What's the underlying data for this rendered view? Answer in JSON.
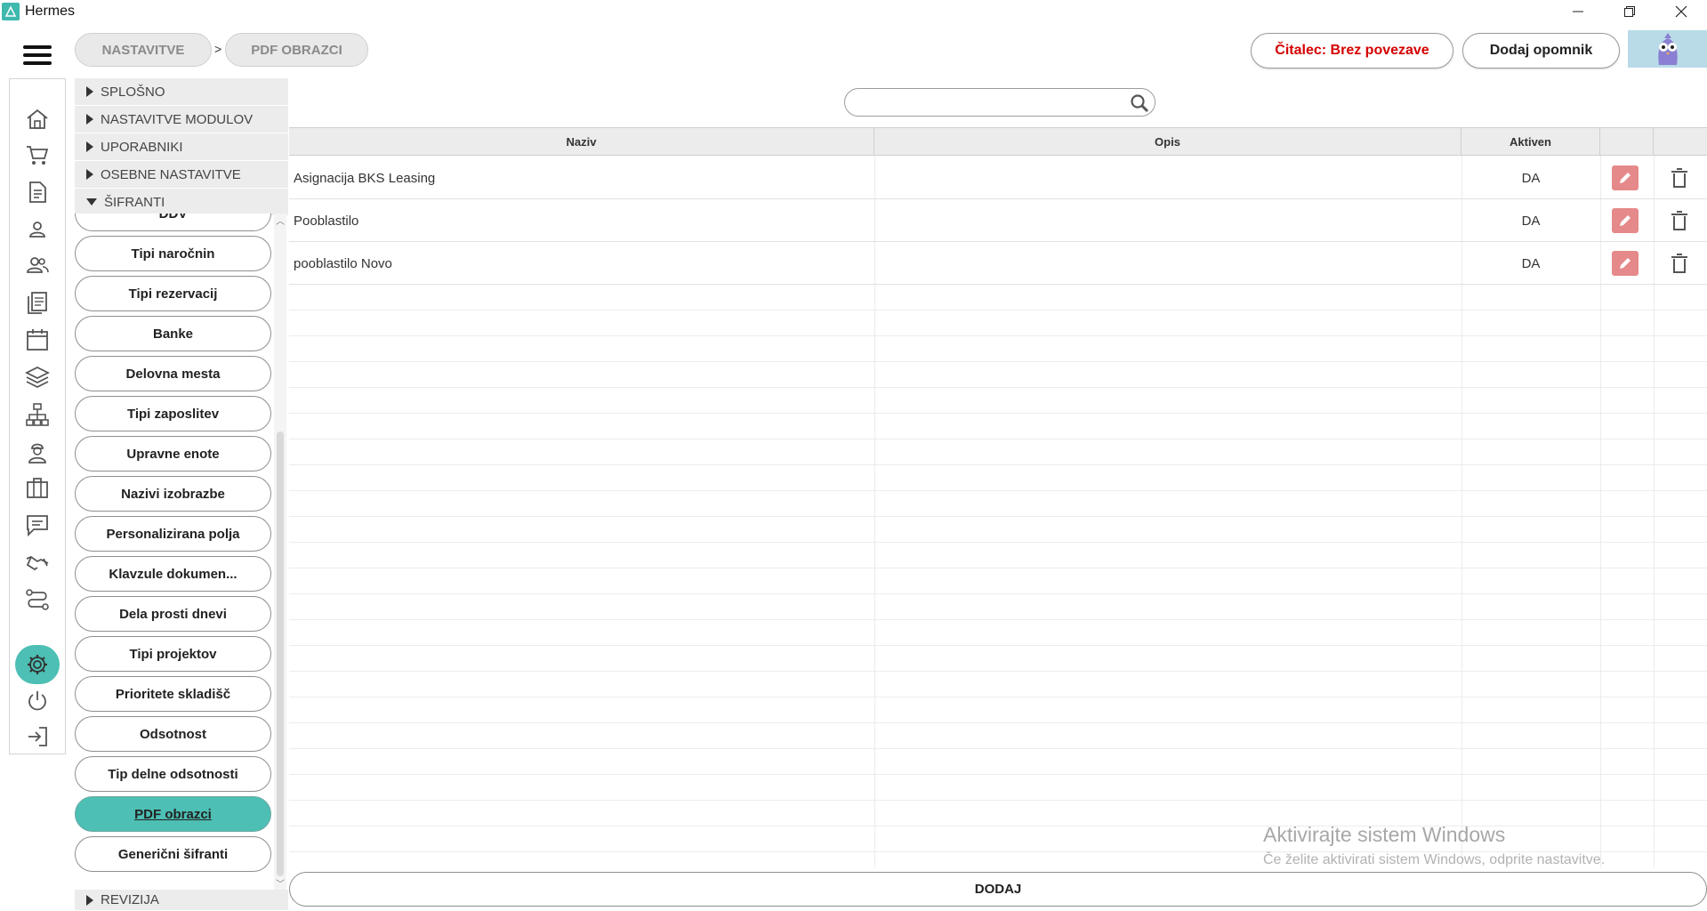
{
  "window": {
    "title": "Hermes"
  },
  "header": {
    "breadcrumbs": [
      "NASTAVITVE",
      "PDF OBRAZCI"
    ],
    "breadcrumb_separator": ">",
    "reader_status": "Čitalec: Brez povezave",
    "reader_status_color": "#d40000",
    "add_reminder_label": "Dodaj opomnik"
  },
  "sidebar_icons": [
    "home-icon",
    "cart-icon",
    "document-icon",
    "person-icon",
    "people-icon",
    "documents-icon",
    "calendar-icon",
    "layers-icon",
    "hierarchy-icon",
    "worker-icon",
    "briefcase-icon",
    "chat-icon",
    "handshake-icon",
    "route-icon",
    "gear-icon",
    "power-icon",
    "logout-icon"
  ],
  "settings_tree": {
    "sections": [
      "SPLOŠNO",
      "NASTAVITVE MODULOV",
      "UPORABNIKI",
      "OSEBNE NASTAVITVE",
      "ŠIFRANTI",
      "REVIZIJA"
    ],
    "expanded": "ŠIFRANTI",
    "items": [
      "DDV",
      "Tipi naročnin",
      "Tipi rezervacij",
      "Banke",
      "Delovna mesta",
      "Tipi zaposlitev",
      "Upravne enote",
      "Nazivi izobrazbe",
      "Personalizirana polja",
      "Klavzule dokumen...",
      "Dela prosti dnevi",
      "Tipi projektov",
      "Prioritete skladišč",
      "Odsotnost",
      "Tip delne odsotnosti",
      "PDF obrazci",
      "Generični šifranti"
    ],
    "active_item": "PDF obrazci",
    "accent_color": "#4dbfb4"
  },
  "search": {
    "placeholder": ""
  },
  "table": {
    "columns": [
      "Naziv",
      "Opis",
      "Aktiven"
    ],
    "rows": [
      {
        "naziv": "Asignacija BKS Leasing",
        "opis": "",
        "aktiven": "DA"
      },
      {
        "naziv": "Pooblastilo",
        "opis": "",
        "aktiven": "DA"
      },
      {
        "naziv": "pooblastilo Novo",
        "opis": "",
        "aktiven": "DA"
      }
    ]
  },
  "add_button_label": "DODAJ",
  "watermark": {
    "title": "Aktivirajte sistem Windows",
    "subtitle": "Če želite aktivirati sistem Windows, odprite nastavitve."
  }
}
